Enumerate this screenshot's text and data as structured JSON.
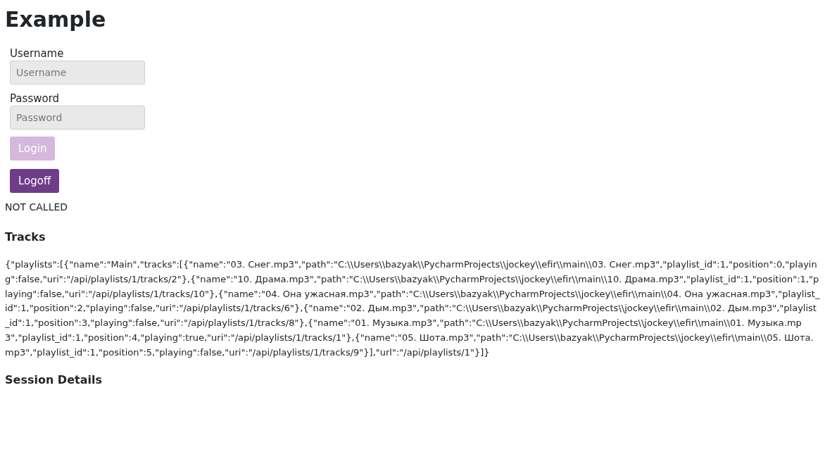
{
  "title": "Example",
  "form": {
    "fields": [
      {
        "label": "Username",
        "placeholder": "Username"
      },
      {
        "label": "Password",
        "placeholder": "Password"
      }
    ],
    "buttons": [
      {
        "label": "Login",
        "disabled": true
      },
      {
        "label": "Logoff",
        "disabled": false
      }
    ]
  },
  "status": "NOT CALLED",
  "tracks": {
    "heading": "Tracks",
    "json_text": "{\"playlists\":[{\"name\":\"Main\",\"tracks\":[{\"name\":\"03. Снег.mp3\",\"path\":\"C:\\\\Users\\\\bazyak\\\\PycharmProjects\\\\jockey\\\\efir\\\\main\\\\03. Снег.mp3\",\"playlist_id\":1,\"position\":0,\"playing\":false,\"uri\":\"/api/playlists/1/tracks/2\"},{\"name\":\"10. Драма.mp3\",\"path\":\"C:\\\\Users\\\\bazyak\\\\PycharmProjects\\\\jockey\\\\efir\\\\main\\\\10. Драма.mp3\",\"playlist_id\":1,\"position\":1,\"playing\":false,\"uri\":\"/api/playlists/1/tracks/10\"},{\"name\":\"04. Она ужасная.mp3\",\"path\":\"C:\\\\Users\\\\bazyak\\\\PycharmProjects\\\\jockey\\\\efir\\\\main\\\\04. Она ужасная.mp3\",\"playlist_id\":1,\"position\":2,\"playing\":false,\"uri\":\"/api/playlists/1/tracks/6\"},{\"name\":\"02. Дым.mp3\",\"path\":\"C:\\\\Users\\\\bazyak\\\\PycharmProjects\\\\jockey\\\\efir\\\\main\\\\02. Дым.mp3\",\"playlist_id\":1,\"position\":3,\"playing\":false,\"uri\":\"/api/playlists/1/tracks/8\"},{\"name\":\"01. Музыка.mp3\",\"path\":\"C:\\\\Users\\\\bazyak\\\\PycharmProjects\\\\jockey\\\\efir\\\\main\\\\01. Музыка.mp3\",\"playlist_id\":1,\"position\":4,\"playing\":true,\"uri\":\"/api/playlists/1/tracks/1\"},{\"name\":\"05. Шота.mp3\",\"path\":\"C:\\\\Users\\\\bazyak\\\\PycharmProjects\\\\jockey\\\\efir\\\\main\\\\05. Шота.mp3\",\"playlist_id\":1,\"position\":5,\"playing\":false,\"uri\":\"/api/playlists/1/tracks/9\"}],\"url\":\"/api/playlists/1\"}]}"
  },
  "session": {
    "heading": "Session Details"
  }
}
